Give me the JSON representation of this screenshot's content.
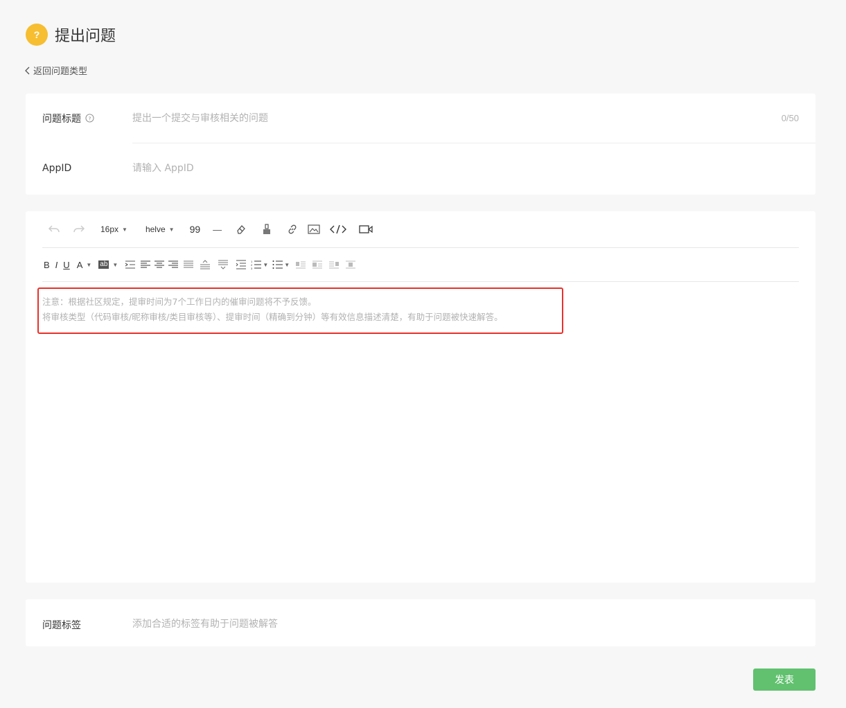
{
  "header": {
    "icon_glyph": "?",
    "title": "提出问题",
    "accent_color": "#f6be30"
  },
  "back_link": {
    "label": "返回问题类型"
  },
  "form": {
    "title_field": {
      "label": "问题标题",
      "placeholder": "提出一个提交与审核相关的问题",
      "counter": "0/50"
    },
    "appid_field": {
      "label": "AppID",
      "placeholder": "请输入 AppID"
    }
  },
  "editor": {
    "toolbar1": {
      "font_size": "16px",
      "font_family": "helve",
      "quote": "99",
      "hr": "—"
    },
    "toolbar2": {
      "bold": "B",
      "italic": "I",
      "underline": "U",
      "font_color": "A",
      "bg_color": "ab"
    },
    "hint_line1": "注意：根据社区规定，提审时间为7个工作日内的催审问题将不予反馈。",
    "hint_line2": "将审核类型（代码审核/昵称审核/类目审核等）、提审时间（精确到分钟）等有效信息描述清楚，有助于问题被快速解答。"
  },
  "tags": {
    "label": "问题标签",
    "placeholder": "添加合适的标签有助于问题被解答"
  },
  "submit": {
    "label": "发表",
    "color": "#61c16f"
  }
}
